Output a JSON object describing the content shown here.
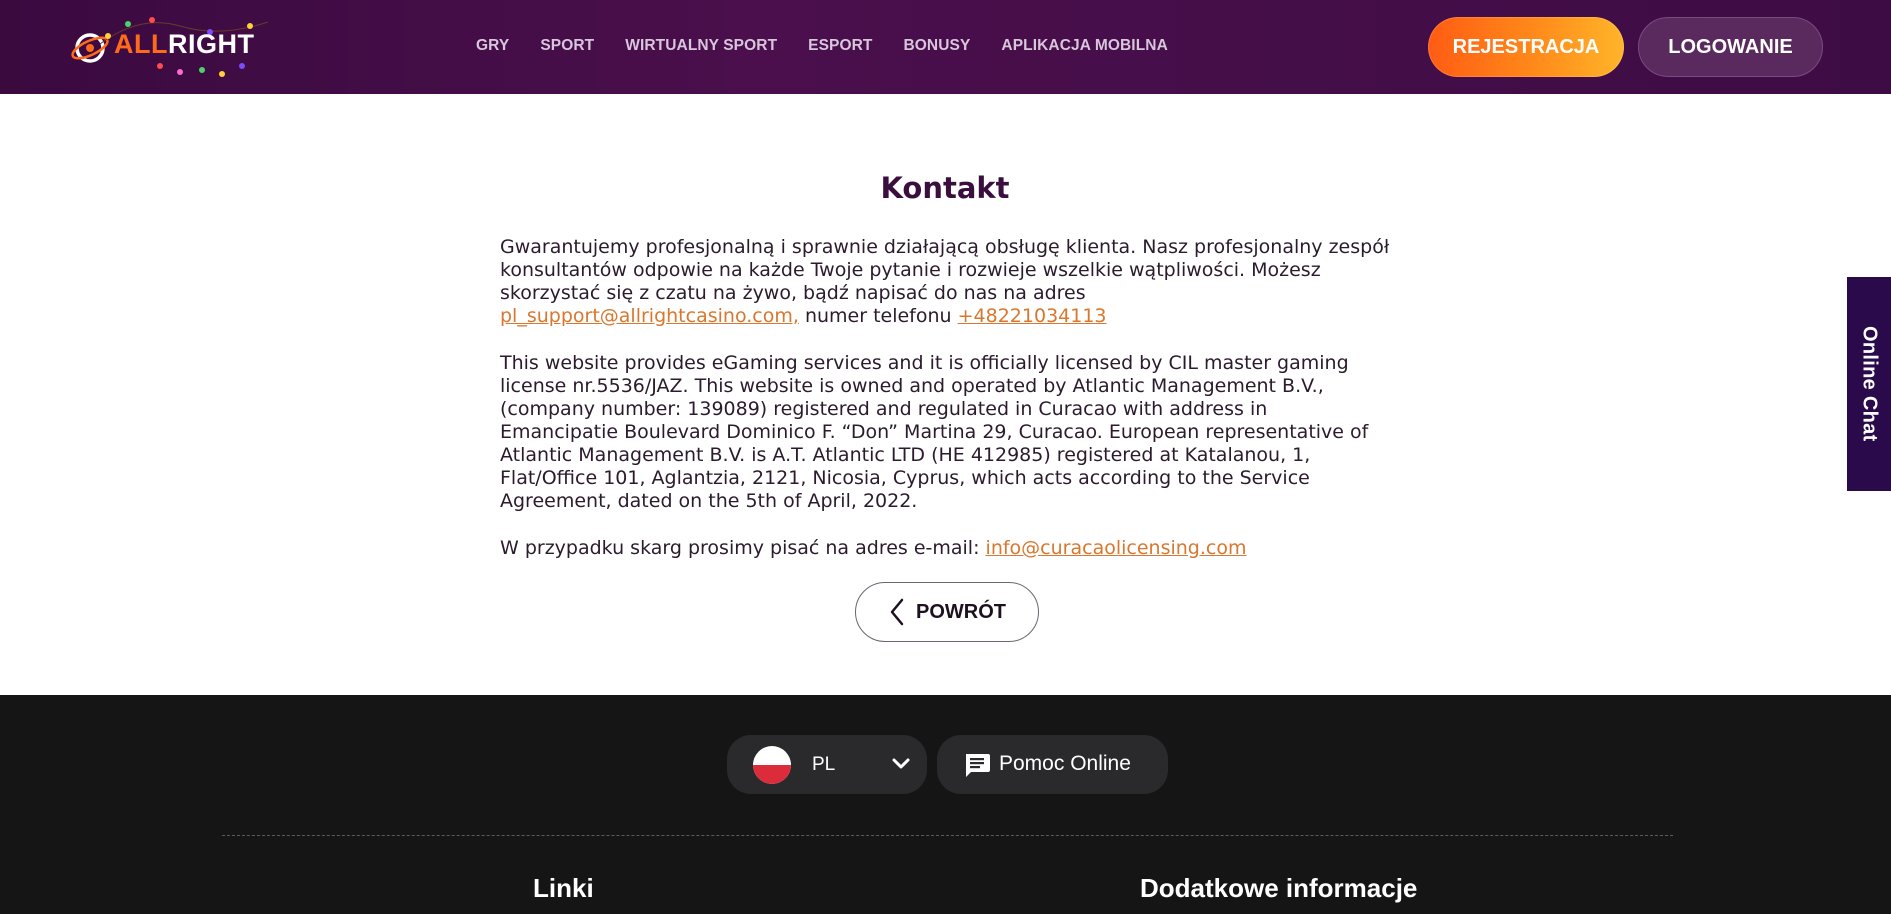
{
  "header": {
    "logo": {
      "part1": "ALL",
      "part2": "RIGHT"
    },
    "nav": [
      "GRY",
      "SPORT",
      "WIRTUALNY SPORT",
      "ESPORT",
      "BONUSY",
      "APLIKACJA MOBILNA"
    ],
    "register_label": "REJESTRACJA",
    "login_label": "LOGOWANIE",
    "colors": {
      "register_gradient_start": "#ff5c13",
      "register_gradient_end": "#ffb52a",
      "header_bg": "#3a0a3f"
    }
  },
  "main": {
    "title": "Kontakt",
    "p1": {
      "text": "Gwarantujemy profesjonalną i sprawnie działającą obsługę klienta. Nasz profesjonalny zespół konsultantów odpowie na każde Twoje pytanie i rozwieje wszelkie wątpliwości. Możesz skorzystać się z czatu na żywo, bądź napisać do nas na adres",
      "email": "pl_support@allrightcasino.com,",
      "phone_prefix": "numer telefonu",
      "phone": "+48221034113"
    },
    "p2": "This website provides eGaming services and it is officially licensed by CIL master gaming license nr.5536/JAZ. This website is owned and operated by Atlantic Management B.V., (company number: 139089) registered and regulated in Curacao with address in Emancipatie Boulevard Dominico F. “Don” Martina 29, Curacao. European representative of Atlantic Management B.V. is A.T. Atlantic LTD (HE 412985) registered at Katalanou, 1, Flat/Office 101, Aglantzia, 2121, Nicosia, Cyprus, which acts according to the Service Agreement, dated on the 5th of April, 2022.",
    "p3": {
      "text": "W przypadku skarg prosimy pisać na adres e-mail:",
      "email": "info@curacaolicensing.com"
    },
    "back_label": "POWRÓT",
    "link_color": "#d9772e"
  },
  "side_chat": {
    "label": "Online Chat"
  },
  "footer": {
    "language": "PL",
    "help_label": "Pomoc Online",
    "col1_title": "Linki",
    "col2_title": "Dodatkowe informacje"
  }
}
